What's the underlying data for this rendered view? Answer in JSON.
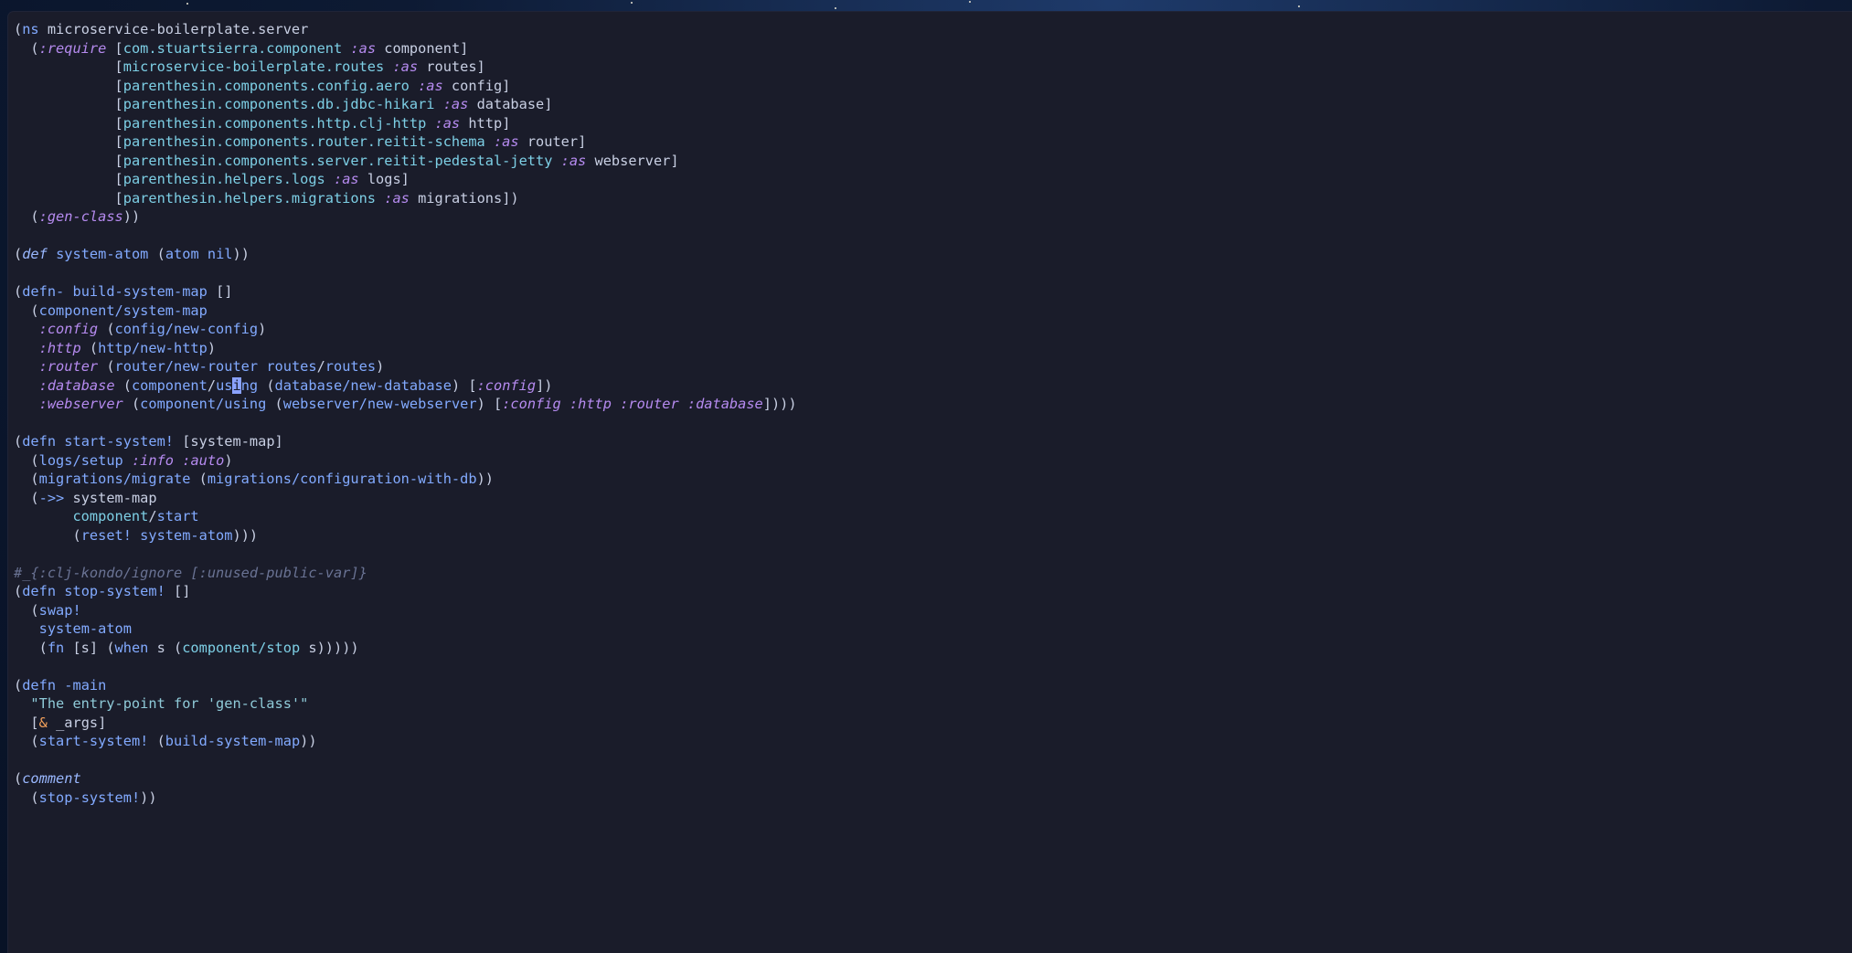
{
  "theme": {
    "background": "#1a1c2a",
    "text": "#c8cfe3",
    "function": "#82aaff",
    "namespace": "#7dcfe5",
    "keyword": "#b68bf0",
    "string": "#8fcad8",
    "comment": "#6a7394",
    "cursor": "#8aa2ff"
  },
  "editor": {
    "cursor_line": 20,
    "lines": [
      [
        [
          "(",
          "plain"
        ],
        [
          "ns",
          "fn"
        ],
        [
          " microservice-boilerplate.server",
          "plain"
        ]
      ],
      [
        [
          "  (",
          "plain"
        ],
        [
          ":require",
          "kw"
        ],
        [
          " [",
          "plain"
        ],
        [
          "com.stuartsierra.component",
          "ns"
        ],
        [
          " ",
          "plain"
        ],
        [
          ":as",
          "kw"
        ],
        [
          " component]",
          "plain"
        ]
      ],
      [
        [
          "            [",
          "plain"
        ],
        [
          "microservice-boilerplate.routes",
          "ns"
        ],
        [
          " ",
          "plain"
        ],
        [
          ":as",
          "kw"
        ],
        [
          " routes]",
          "plain"
        ]
      ],
      [
        [
          "            [",
          "plain"
        ],
        [
          "parenthesin.components.config.aero",
          "ns"
        ],
        [
          " ",
          "plain"
        ],
        [
          ":as",
          "kw"
        ],
        [
          " config]",
          "plain"
        ]
      ],
      [
        [
          "            [",
          "plain"
        ],
        [
          "parenthesin.components.db.jdbc-hikari",
          "ns"
        ],
        [
          " ",
          "plain"
        ],
        [
          ":as",
          "kw"
        ],
        [
          " database]",
          "plain"
        ]
      ],
      [
        [
          "            [",
          "plain"
        ],
        [
          "parenthesin.components.http.clj-http",
          "ns"
        ],
        [
          " ",
          "plain"
        ],
        [
          ":as",
          "kw"
        ],
        [
          " http]",
          "plain"
        ]
      ],
      [
        [
          "            [",
          "plain"
        ],
        [
          "parenthesin.components.router.reitit-schema",
          "ns"
        ],
        [
          " ",
          "plain"
        ],
        [
          ":as",
          "kw"
        ],
        [
          " router]",
          "plain"
        ]
      ],
      [
        [
          "            [",
          "plain"
        ],
        [
          "parenthesin.components.server.reitit-pedestal-jetty",
          "ns"
        ],
        [
          " ",
          "plain"
        ],
        [
          ":as",
          "kw"
        ],
        [
          " webserver]",
          "plain"
        ]
      ],
      [
        [
          "            [",
          "plain"
        ],
        [
          "parenthesin.helpers.logs",
          "ns"
        ],
        [
          " ",
          "plain"
        ],
        [
          ":as",
          "kw"
        ],
        [
          " logs]",
          "plain"
        ]
      ],
      [
        [
          "            [",
          "plain"
        ],
        [
          "parenthesin.helpers.migrations",
          "ns"
        ],
        [
          " ",
          "plain"
        ],
        [
          ":as",
          "kw"
        ],
        [
          " migrations])",
          "plain"
        ]
      ],
      [
        [
          "  (",
          "plain"
        ],
        [
          ":gen-class",
          "kw"
        ],
        [
          "))",
          "plain"
        ]
      ],
      [],
      [
        [
          "(",
          "plain"
        ],
        [
          "def",
          "special"
        ],
        [
          " ",
          "plain"
        ],
        [
          "system-atom",
          "fn"
        ],
        [
          " (",
          "plain"
        ],
        [
          "atom",
          "fn"
        ],
        [
          " ",
          "plain"
        ],
        [
          "nil",
          "fn"
        ],
        [
          "))",
          "plain"
        ]
      ],
      [],
      [
        [
          "(",
          "plain"
        ],
        [
          "defn-",
          "fn"
        ],
        [
          " ",
          "plain"
        ],
        [
          "build-system-map",
          "fn"
        ],
        [
          " []",
          "plain"
        ]
      ],
      [
        [
          "  (",
          "plain"
        ],
        [
          "component/system-map",
          "fn"
        ]
      ],
      [
        [
          "   ",
          "plain"
        ],
        [
          ":config",
          "kw"
        ],
        [
          " (",
          "plain"
        ],
        [
          "config/new-config",
          "fn"
        ],
        [
          ")",
          "plain"
        ]
      ],
      [
        [
          "   ",
          "plain"
        ],
        [
          ":http",
          "kw"
        ],
        [
          " (",
          "plain"
        ],
        [
          "http/new-http",
          "fn"
        ],
        [
          ")",
          "plain"
        ]
      ],
      [
        [
          "   ",
          "plain"
        ],
        [
          ":router",
          "kw"
        ],
        [
          " (",
          "plain"
        ],
        [
          "router/new-router",
          "fn"
        ],
        [
          " ",
          "plain"
        ],
        [
          "routes",
          "fn"
        ],
        [
          "/",
          "plain"
        ],
        [
          "routes",
          "fn"
        ],
        [
          ")",
          "plain"
        ]
      ],
      [
        [
          "   ",
          "plain"
        ],
        [
          ":database",
          "kw"
        ],
        [
          " (",
          "plain"
        ],
        [
          "component",
          "fn"
        ],
        [
          "/",
          "plain"
        ],
        [
          "us",
          "fn"
        ],
        [
          "i",
          "cursor"
        ],
        [
          "ng",
          "fn"
        ],
        [
          " (",
          "plain"
        ],
        [
          "database/new-database",
          "fn"
        ],
        [
          ") [",
          "plain"
        ],
        [
          ":config",
          "kw"
        ],
        [
          "])",
          "plain"
        ]
      ],
      [
        [
          "   ",
          "plain"
        ],
        [
          ":webserver",
          "kw"
        ],
        [
          " (",
          "plain"
        ],
        [
          "component/using",
          "fn"
        ],
        [
          " (",
          "plain"
        ],
        [
          "webserver/new-webserver",
          "fn"
        ],
        [
          ") [",
          "plain"
        ],
        [
          ":config",
          "kw"
        ],
        [
          " ",
          "plain"
        ],
        [
          ":http",
          "kw"
        ],
        [
          " ",
          "plain"
        ],
        [
          ":router",
          "kw"
        ],
        [
          " ",
          "plain"
        ],
        [
          ":database",
          "kw"
        ],
        [
          "])))",
          "plain"
        ]
      ],
      [],
      [
        [
          "(",
          "plain"
        ],
        [
          "defn",
          "fn"
        ],
        [
          " ",
          "plain"
        ],
        [
          "start-system!",
          "fn"
        ],
        [
          " [system-map]",
          "plain"
        ]
      ],
      [
        [
          "  (",
          "plain"
        ],
        [
          "logs/setup",
          "fn"
        ],
        [
          " ",
          "plain"
        ],
        [
          ":info",
          "kw"
        ],
        [
          " ",
          "plain"
        ],
        [
          ":auto",
          "kw"
        ],
        [
          ")",
          "plain"
        ]
      ],
      [
        [
          "  (",
          "plain"
        ],
        [
          "migrations/migrate",
          "fn"
        ],
        [
          " (",
          "plain"
        ],
        [
          "migrations/configuration-with-db",
          "fn"
        ],
        [
          "))",
          "plain"
        ]
      ],
      [
        [
          "  (",
          "plain"
        ],
        [
          "->>",
          "fn"
        ],
        [
          " system-map",
          "plain"
        ]
      ],
      [
        [
          "       ",
          "plain"
        ],
        [
          "component",
          "ns"
        ],
        [
          "/",
          "plain"
        ],
        [
          "start",
          "fn"
        ]
      ],
      [
        [
          "       (",
          "plain"
        ],
        [
          "reset!",
          "fn"
        ],
        [
          " ",
          "plain"
        ],
        [
          "system-atom",
          "fn"
        ],
        [
          ")))",
          "plain"
        ]
      ],
      [],
      [
        [
          "#_{:clj-kondo/ignore [:unused-public-var]}",
          "comment"
        ]
      ],
      [
        [
          "(",
          "plain"
        ],
        [
          "defn",
          "fn"
        ],
        [
          " ",
          "plain"
        ],
        [
          "stop-system!",
          "fn"
        ],
        [
          " []",
          "plain"
        ]
      ],
      [
        [
          "  (",
          "plain"
        ],
        [
          "swap!",
          "fn"
        ]
      ],
      [
        [
          "   ",
          "plain"
        ],
        [
          "system-atom",
          "fn"
        ]
      ],
      [
        [
          "   (",
          "plain"
        ],
        [
          "fn",
          "fn"
        ],
        [
          " [s] (",
          "plain"
        ],
        [
          "when",
          "fn"
        ],
        [
          " s (",
          "plain"
        ],
        [
          "component/stop",
          "ns"
        ],
        [
          " s)))))",
          "plain"
        ]
      ],
      [],
      [
        [
          "(",
          "plain"
        ],
        [
          "defn",
          "fn"
        ],
        [
          " ",
          "plain"
        ],
        [
          "-main",
          "fn"
        ]
      ],
      [
        [
          "  ",
          "plain"
        ],
        [
          "\"The entry-point for 'gen-class'\"",
          "str"
        ]
      ],
      [
        [
          "  [",
          "plain"
        ],
        [
          "&",
          "amp"
        ],
        [
          " _args]",
          "plain"
        ]
      ],
      [
        [
          "  (",
          "plain"
        ],
        [
          "start-system!",
          "fn"
        ],
        [
          " (",
          "plain"
        ],
        [
          "build-system-map",
          "fn"
        ],
        [
          "))",
          "plain"
        ]
      ],
      [],
      [
        [
          "(",
          "plain"
        ],
        [
          "comment",
          "special"
        ]
      ],
      [
        [
          "  (",
          "plain"
        ],
        [
          "stop-system!",
          "fn"
        ],
        [
          "))",
          "plain"
        ]
      ]
    ]
  }
}
